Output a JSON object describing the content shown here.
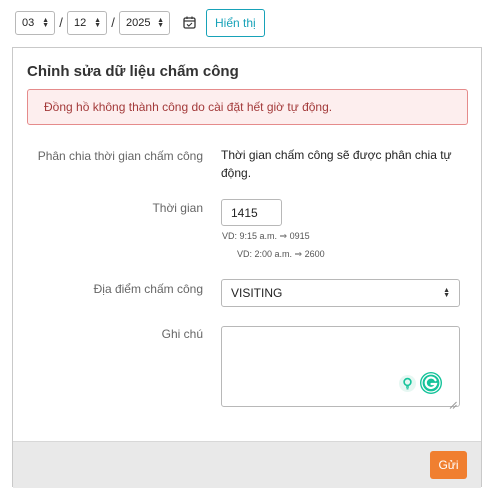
{
  "date_picker": {
    "month": "03",
    "day": "12",
    "year": "2025",
    "separator": "/",
    "show_button": "Hiển thị"
  },
  "card": {
    "title": "Chỉnh sửa dữ liệu chấm công",
    "alert": "Đồng hồ không thành công do cài đặt hết giờ tự động.",
    "fields": {
      "division_label": "Phân chia thời gian chấm công",
      "division_value_line1": "Thời gian chấm công sẽ được phân chia tự",
      "division_value_line2": "động.",
      "time_label": "Thời gian",
      "time_value": "1415",
      "time_hint1": "VD: 9:15 a.m. ⇒ 0915",
      "time_hint2": "VD: 2:00 a.m. ⇒ 2600",
      "location_label": "Địa điểm chấm công",
      "location_value": "VISITING",
      "note_label": "Ghi chú",
      "note_value": ""
    },
    "submit_button": "Gửi"
  },
  "colors": {
    "accent_teal": "#17a2b8",
    "submit_orange": "#f07f30",
    "alert_bg": "#fdeeee",
    "alert_text": "#a33a3a",
    "grammarly_green": "#15c39a"
  }
}
